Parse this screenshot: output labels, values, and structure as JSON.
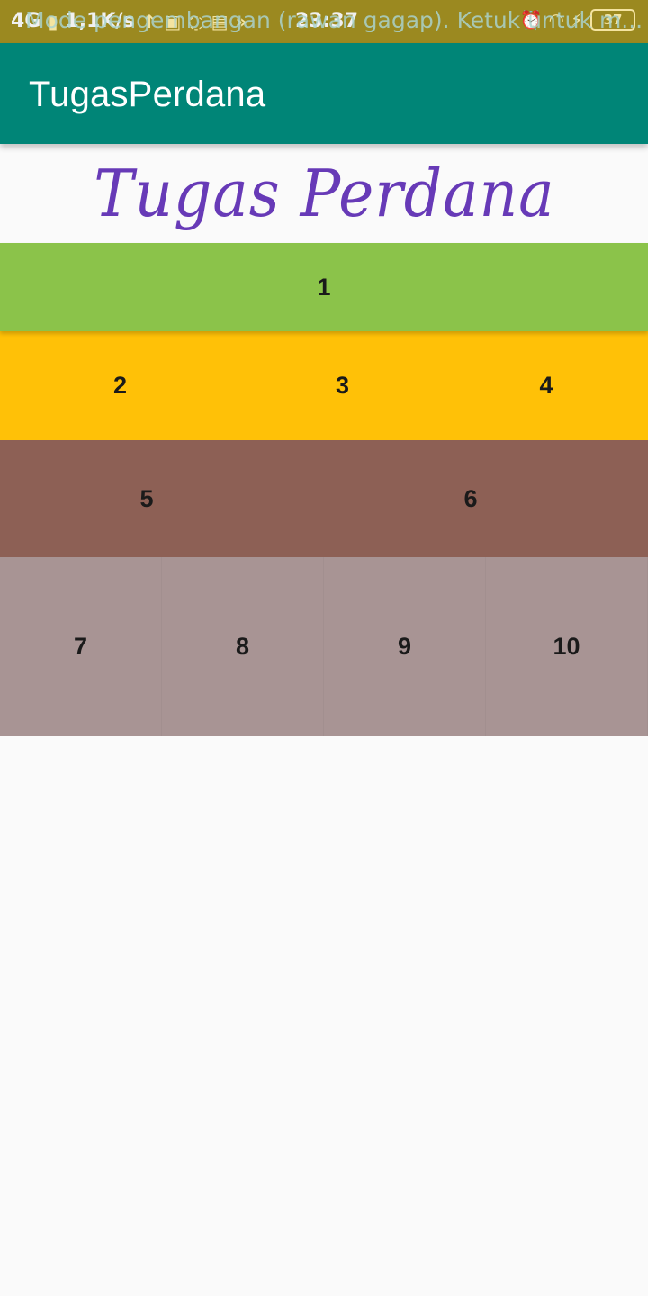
{
  "status_bar": {
    "network": "4G",
    "signal_icon": "signal-icon",
    "speed": "1,1K/s",
    "time": "23:37",
    "notification": "Mode pengembangan (rawan gagap). Ketuk untuk m...",
    "battery": "37"
  },
  "app_bar": {
    "title": "TugasPerdana"
  },
  "heading": {
    "text": "Tugas Perdana",
    "color": "#673ab7"
  },
  "colors": {
    "app_bar": "#008577",
    "row_1": "#8bc34a",
    "row_2": "#ffc107",
    "row_3": "#8d6055",
    "row_4": "#a89494"
  },
  "rows": {
    "row_1": [
      "1"
    ],
    "row_2": [
      "2",
      "3",
      "4"
    ],
    "row_3": [
      "5",
      "6"
    ],
    "row_4": [
      "7",
      "8",
      "9",
      "10"
    ]
  }
}
